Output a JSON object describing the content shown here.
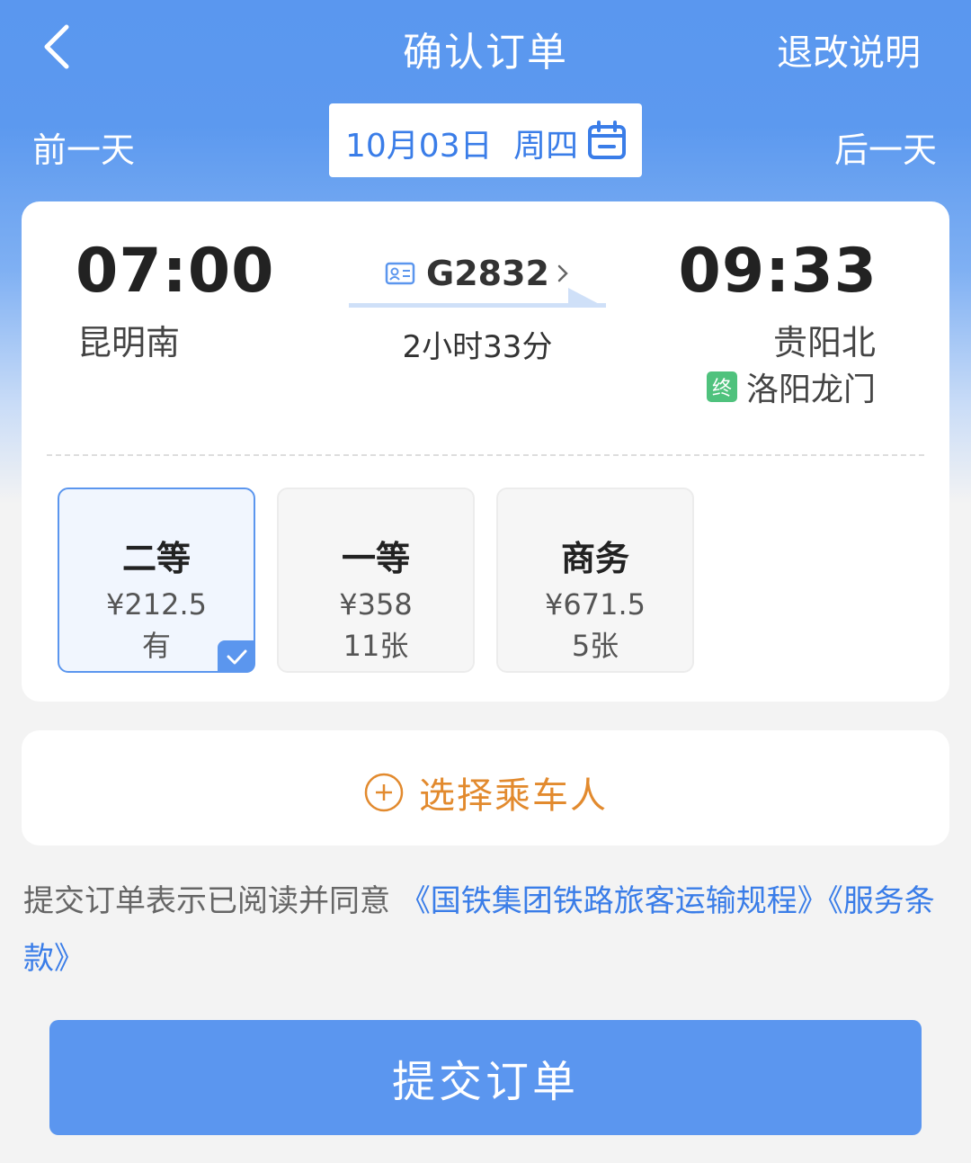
{
  "header": {
    "title": "确认订单",
    "rules_link": "退改说明"
  },
  "date_nav": {
    "prev_label": "前一天",
    "next_label": "后一天",
    "date": "10月03日",
    "weekday": "周四",
    "calendar_icon": "calendar-icon"
  },
  "train": {
    "departure_time": "07:00",
    "departure_station": "昆明南",
    "arrival_time": "09:33",
    "arrival_station": "贵阳北",
    "train_number": "G2832",
    "duration": "2小时33分",
    "terminal_badge": "终",
    "terminal_station": "洛阳龙门"
  },
  "seats": [
    {
      "name": "二等",
      "price": "¥212.5",
      "availability": "有",
      "selected": true
    },
    {
      "name": "一等",
      "price": "¥358",
      "availability": "11张",
      "selected": false
    },
    {
      "name": "商务",
      "price": "¥671.5",
      "availability": "5张",
      "selected": false
    }
  ],
  "passenger": {
    "add_label": "选择乘车人"
  },
  "agreement": {
    "prefix": "提交订单表示已阅读并同意 ",
    "link1": "《国铁集团铁路旅客运输规程》",
    "link2": "《服务条款》"
  },
  "submit_label": "提交订单",
  "colors": {
    "primary": "#5b96ef",
    "link": "#3a7de8",
    "accent_orange": "#e28a2e",
    "terminal_green": "#4fc27d"
  }
}
